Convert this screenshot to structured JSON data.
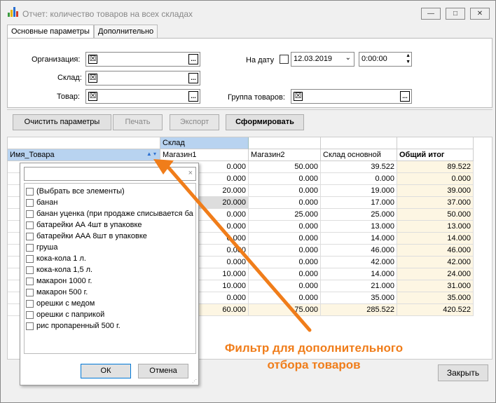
{
  "window": {
    "title": "Отчет: количество товаров на всех складах",
    "min": "—",
    "max": "□",
    "close": "✕"
  },
  "tabs": [
    "Основные параметры",
    "Дополнительно"
  ],
  "params": {
    "org_label": "Организация:",
    "warehouse_label": "Склад:",
    "product_label": "Товар:",
    "date_label": "На дату",
    "date_value": "12.03.2019",
    "time_value": "0:00:00",
    "group_label": "Группа товаров:",
    "x_mark": "☒",
    "dots": "..."
  },
  "toolbar": {
    "clear": "Очистить параметры",
    "print": "Печать",
    "export": "Экспорт",
    "build": "Сформировать"
  },
  "grid": {
    "group_header": "Склад",
    "columns": [
      "Имя_Товара",
      "Магазин1",
      "Магазин2",
      "Склад основной",
      "Общий итог"
    ],
    "rows": [
      [
        "0.000",
        "50.000",
        "39.522",
        "89.522"
      ],
      [
        "0.000",
        "0.000",
        "0.000",
        "0.000"
      ],
      [
        "20.000",
        "0.000",
        "19.000",
        "39.000"
      ],
      [
        "20.000",
        "0.000",
        "17.000",
        "37.000"
      ],
      [
        "0.000",
        "25.000",
        "25.000",
        "50.000"
      ],
      [
        "0.000",
        "0.000",
        "13.000",
        "13.000"
      ],
      [
        "0.000",
        "0.000",
        "14.000",
        "14.000"
      ],
      [
        "0.000",
        "0.000",
        "46.000",
        "46.000"
      ],
      [
        "0.000",
        "0.000",
        "42.000",
        "42.000"
      ],
      [
        "10.000",
        "0.000",
        "14.000",
        "24.000"
      ],
      [
        "10.000",
        "0.000",
        "21.000",
        "31.000"
      ],
      [
        "0.000",
        "0.000",
        "35.000",
        "35.000"
      ],
      [
        "60.000",
        "75.000",
        "285.522",
        "420.522"
      ]
    ]
  },
  "filter": {
    "search_clear": "×",
    "items": [
      "(Выбрать все элементы)",
      "банан",
      "банан уценка (при продаже списывается ба",
      "батарейки АА 4шт в упаковке",
      "батарейки ААА 8шт в упаковке",
      "груша",
      "кока-кола 1 л.",
      "кока-кола 1,5 л.",
      "макарон 1000 г.",
      "макарон 500 г.",
      "орешки с медом",
      "орешки с паприкой",
      "рис пропаренный 500 г."
    ],
    "ok": "ОК",
    "cancel": "Отмена"
  },
  "annotation": {
    "line1": "Фильтр для дополнительного",
    "line2": "отбора товаров",
    "color": "#f07d1a"
  },
  "close_button": "Закрыть"
}
